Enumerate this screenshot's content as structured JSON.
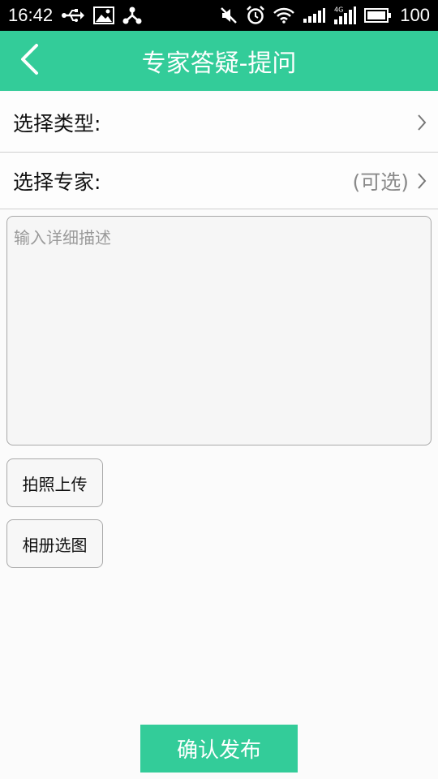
{
  "status_bar": {
    "time": "16:42",
    "battery_level": "100",
    "left_icons": [
      "usb-icon",
      "image-icon",
      "share-icon"
    ],
    "right_icons": [
      "mute-icon",
      "alarm-icon",
      "wifi-icon",
      "signal-icon",
      "signal-4g-icon",
      "battery-icon"
    ]
  },
  "header": {
    "title": "专家答疑-提问",
    "back_icon": "back-arrow-icon",
    "bg_color": "#33cc99"
  },
  "form": {
    "type_row": {
      "label": "选择类型:",
      "icon": "chevron-right-icon"
    },
    "expert_row": {
      "label": "选择专家:",
      "hint": "(可选)",
      "icon": "chevron-right-icon"
    },
    "description": {
      "value": "",
      "placeholder": "输入详细描述"
    },
    "camera_button": {
      "label": "拍照上传"
    },
    "album_button": {
      "label": "相册选图"
    }
  },
  "submit": {
    "label": "确认发布",
    "bg_color": "#33cc99"
  }
}
